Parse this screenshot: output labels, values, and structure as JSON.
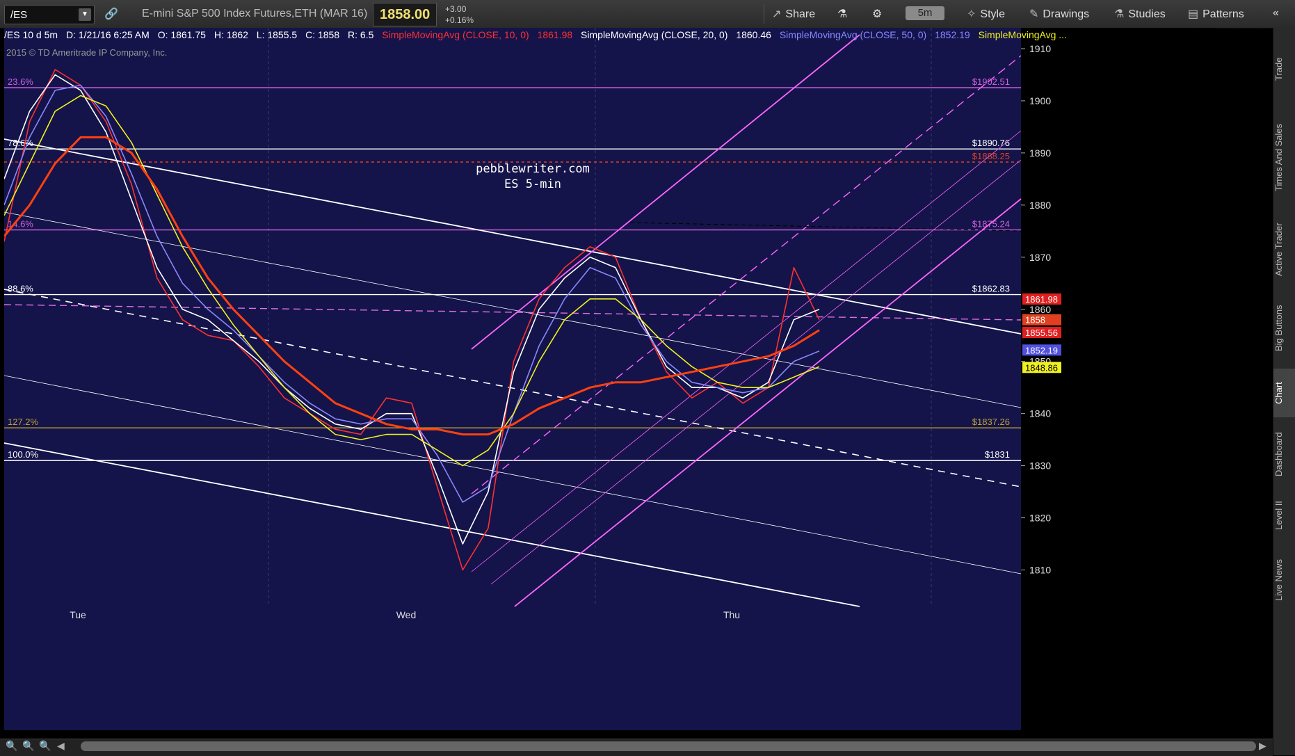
{
  "toolbar": {
    "symbol": "/ES",
    "description": "E-mini S&P 500 Index Futures,ETH (MAR 16)",
    "last_price": "1858.00",
    "change": "+3.00",
    "change_pct": "+0.16%",
    "share": "Share",
    "timeframe": "5m",
    "style": "Style",
    "drawings": "Drawings",
    "studies": "Studies",
    "patterns": "Patterns"
  },
  "info": {
    "header": "/ES 10 d 5m",
    "date": "D: 1/21/16 6:25 AM",
    "open": "O: 1861.75",
    "high": "H: 1862",
    "low": "L: 1855.5",
    "close": "C: 1858",
    "range": "R: 6.5",
    "sma10": "SimpleMovingAvg (CLOSE, 10, 0)",
    "sma10_val": "1861.98",
    "sma20": "SimpleMovingAvg (CLOSE, 20, 0)",
    "sma20_val": "1860.46",
    "sma50": "SimpleMovingAvg (CLOSE, 50, 0)",
    "sma50_val": "1852.19",
    "sma100": "SimpleMovingAvg ...",
    "copyright": "2015 © TD Ameritrade IP Company, Inc."
  },
  "watermark": {
    "line1": "pebblewriter.com",
    "line2": "ES 5-min"
  },
  "side_tabs": [
    "Trade",
    "Times And Sales",
    "Active Trader",
    "Big Buttons",
    "Chart",
    "Dashboard",
    "Level II",
    "Live News"
  ],
  "chart_data": {
    "type": "line",
    "title": "",
    "xlabel": "",
    "ylabel": "",
    "x_ticks": [
      "Tue",
      "Wed",
      "Thu"
    ],
    "y_ticks": [
      1810,
      1820,
      1830,
      1840,
      1850,
      1860,
      1870,
      1880,
      1890,
      1900,
      1910
    ],
    "ylim": [
      1803,
      1914
    ],
    "grid": true,
    "levels": [
      {
        "left": "23.6%",
        "right": "$1902.51",
        "value": 1902.51,
        "color": "#d060e0"
      },
      {
        "left": "78.6%",
        "right": "$1890.76",
        "value": 1890.76,
        "color": "#ffffff"
      },
      {
        "left": "",
        "right": "$1888.25",
        "value": 1888.25,
        "color": "#e04020"
      },
      {
        "left": "14.6%",
        "right": "$1875.24",
        "value": 1875.24,
        "color": "#d060e0"
      },
      {
        "left": "88.6%",
        "right": "$1862.83",
        "value": 1862.83,
        "color": "#ffffff"
      },
      {
        "left": "127.2%",
        "right": "$1837.26",
        "value": 1837.26,
        "color": "#c0a030"
      },
      {
        "left": "100.0%",
        "right": "$1831",
        "value": 1831,
        "color": "#ffffff"
      }
    ],
    "price_labels": [
      {
        "value": 1861.98,
        "text": "1861.98",
        "bg": "#e02020"
      },
      {
        "value": 1858,
        "text": "1858",
        "bg": "#e04020"
      },
      {
        "value": 1855.56,
        "text": "1855.56",
        "bg": "#e02020"
      },
      {
        "value": 1852.19,
        "text": "1852.19",
        "bg": "#5050e0"
      },
      {
        "value": 1848.86,
        "text": "1848.86",
        "bg": "#f0f020"
      }
    ],
    "series": [
      {
        "name": "SimpleMovingAvg (CLOSE, 10, 0)",
        "color": "#ff3030",
        "values": [
          1873,
          1896,
          1906,
          1903,
          1896,
          1884,
          1866,
          1858,
          1855,
          1854,
          1849,
          1843,
          1840,
          1837,
          1836,
          1843,
          1842,
          1826,
          1810,
          1818,
          1850,
          1862,
          1868,
          1872,
          1870,
          1858,
          1848,
          1843,
          1846,
          1842,
          1845,
          1868,
          1858
        ]
      },
      {
        "name": "SimpleMovingAvg (CLOSE, 20, 0)",
        "color": "#ffffff",
        "values": [
          1885,
          1898,
          1905,
          1902,
          1894,
          1881,
          1868,
          1860,
          1858,
          1854,
          1850,
          1845,
          1841,
          1838,
          1837,
          1840,
          1840,
          1828,
          1815,
          1825,
          1848,
          1860,
          1866,
          1870,
          1868,
          1858,
          1849,
          1845,
          1845,
          1843,
          1846,
          1858,
          1860
        ]
      },
      {
        "name": "SimpleMovingAvg (CLOSE, 50, 0)",
        "color": "#8888ff",
        "values": [
          1880,
          1893,
          1902,
          1903,
          1897,
          1886,
          1874,
          1865,
          1860,
          1856,
          1851,
          1846,
          1842,
          1839,
          1838,
          1839,
          1839,
          1832,
          1823,
          1826,
          1840,
          1853,
          1862,
          1868,
          1866,
          1857,
          1850,
          1846,
          1845,
          1844,
          1845,
          1850,
          1852
        ]
      },
      {
        "name": "SimpleMovingAvg ...",
        "color": "#f0f020",
        "values": [
          1878,
          1888,
          1898,
          1901,
          1899,
          1892,
          1882,
          1872,
          1864,
          1857,
          1851,
          1845,
          1840,
          1836,
          1835,
          1836,
          1836,
          1833,
          1830,
          1833,
          1840,
          1850,
          1858,
          1862,
          1862,
          1858,
          1853,
          1849,
          1846,
          1845,
          1845,
          1847,
          1849
        ]
      },
      {
        "name": "",
        "color": "#ff4010",
        "values": [
          1874,
          1880,
          1888,
          1893,
          1893,
          1890,
          1883,
          1874,
          1866,
          1860,
          1855,
          1850,
          1846,
          1842,
          1840,
          1838,
          1837,
          1837,
          1836,
          1836,
          1838,
          1841,
          1843,
          1845,
          1846,
          1846,
          1847,
          1848,
          1849,
          1850,
          1851,
          1853,
          1856
        ]
      }
    ]
  }
}
